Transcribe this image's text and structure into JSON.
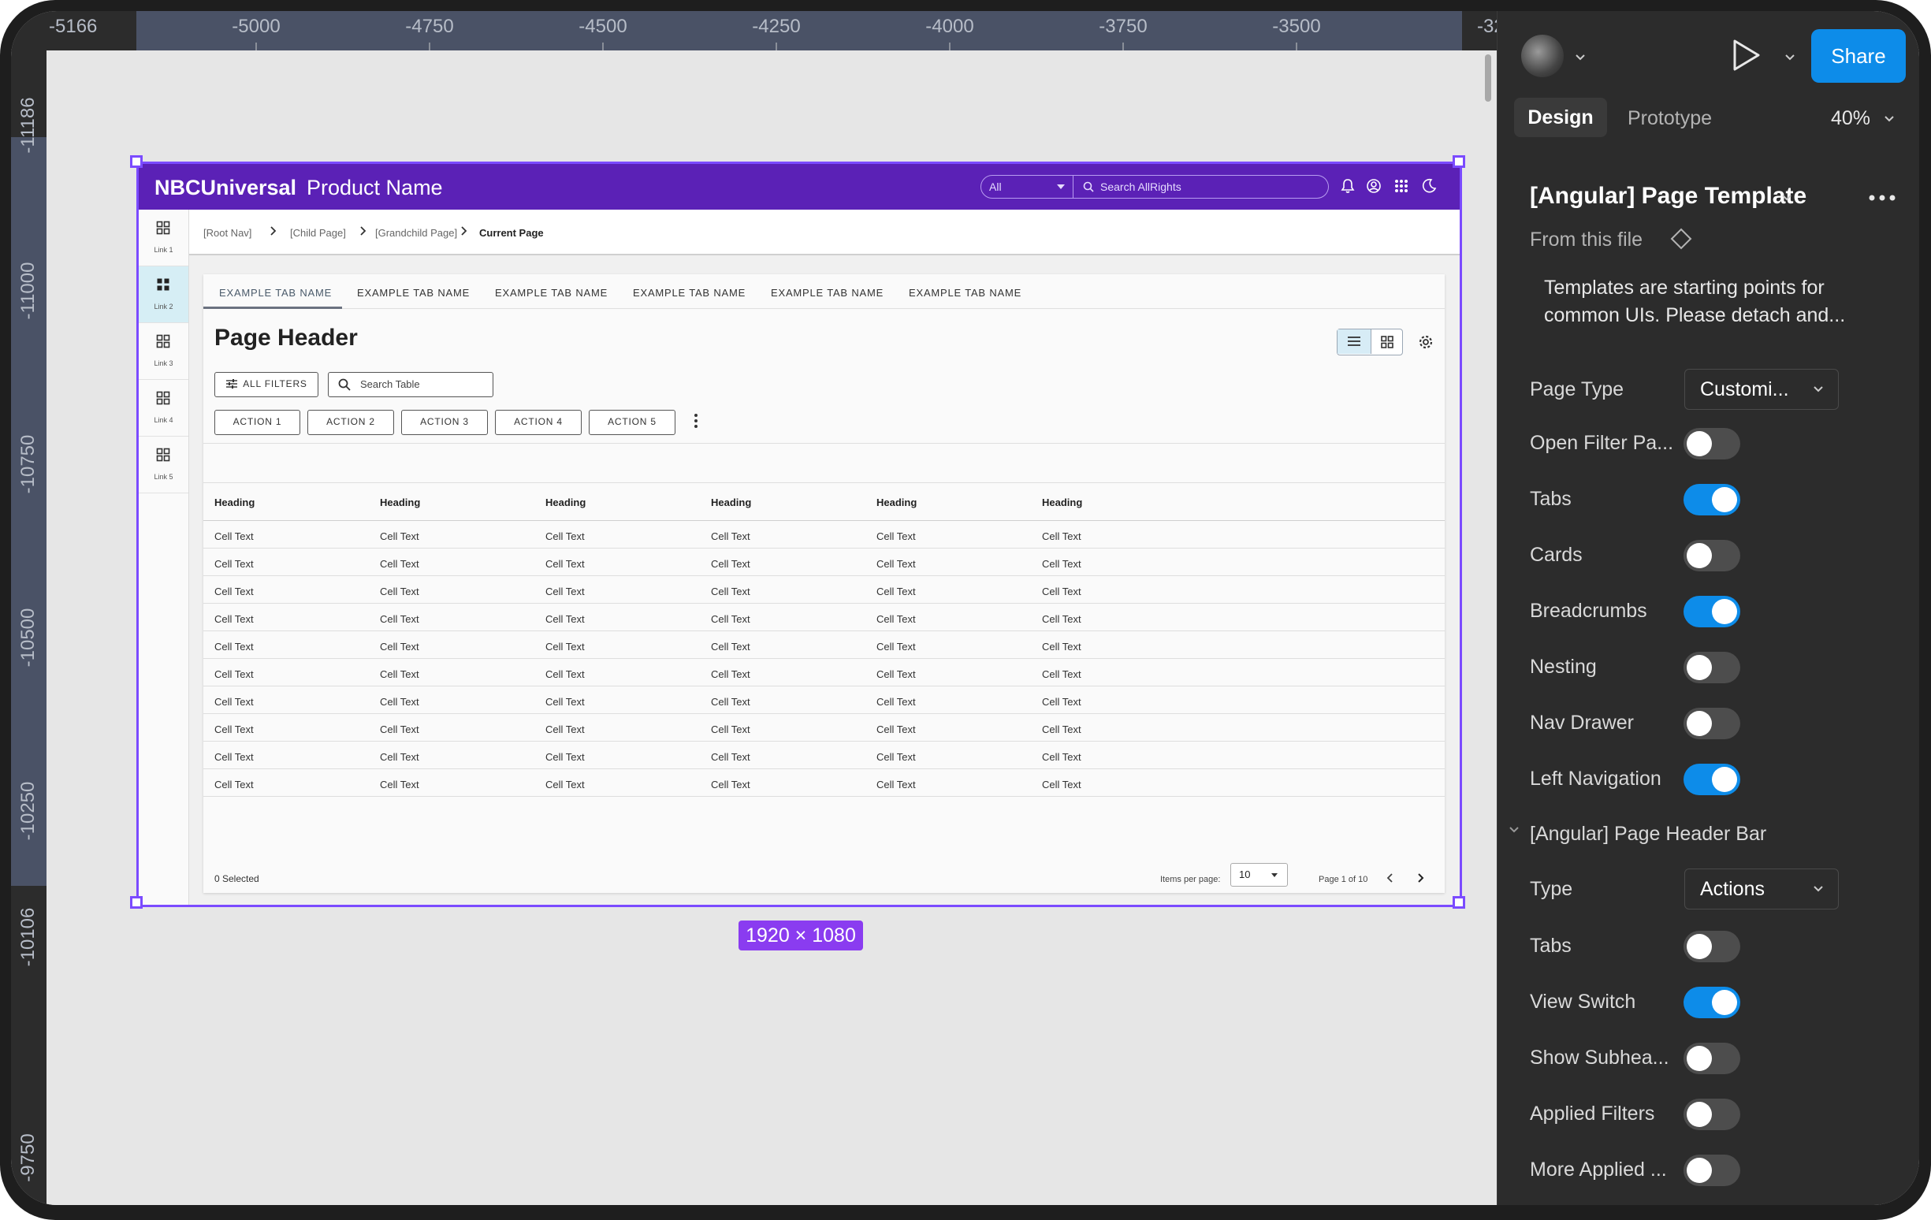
{
  "ruler": {
    "top_ticks": [
      "-5166",
      "-5000",
      "-4750",
      "-4500",
      "-4250",
      "-4000",
      "-3750",
      "-3500",
      "-32"
    ],
    "left_ticks": [
      "-11186",
      "-11000",
      "-10750",
      "-10500",
      "-10250",
      "-10106",
      "-9750"
    ]
  },
  "frame": {
    "size_label": "1920 × 1080"
  },
  "app": {
    "brand": "NBCUniversal",
    "product": "Product Name",
    "scope_value": "All",
    "search_placeholder": "Search AllRights",
    "nav_items": [
      "Link 1",
      "Link 2",
      "Link 3",
      "Link 4",
      "Link 5"
    ],
    "breadcrumbs": [
      "[Root Nav]",
      "[Child Page]",
      "[Grandchild Page]",
      "Current Page"
    ],
    "tabs": [
      "EXAMPLE TAB NAME",
      "EXAMPLE TAB NAME",
      "EXAMPLE TAB NAME",
      "EXAMPLE TAB NAME",
      "EXAMPLE TAB NAME",
      "EXAMPLE TAB NAME"
    ],
    "page_header": "Page Header",
    "all_filters": "ALL FILTERS",
    "search_table": "Search Table",
    "actions": [
      "ACTION 1",
      "ACTION 2",
      "ACTION 3",
      "ACTION 4",
      "ACTION 5"
    ],
    "table": {
      "headers": [
        "Heading",
        "Heading",
        "Heading",
        "Heading",
        "Heading",
        "Heading"
      ],
      "rows": [
        [
          "Cell Text",
          "Cell Text",
          "Cell Text",
          "Cell Text",
          "Cell Text",
          "Cell Text"
        ],
        [
          "Cell Text",
          "Cell Text",
          "Cell Text",
          "Cell Text",
          "Cell Text",
          "Cell Text"
        ],
        [
          "Cell Text",
          "Cell Text",
          "Cell Text",
          "Cell Text",
          "Cell Text",
          "Cell Text"
        ],
        [
          "Cell Text",
          "Cell Text",
          "Cell Text",
          "Cell Text",
          "Cell Text",
          "Cell Text"
        ],
        [
          "Cell Text",
          "Cell Text",
          "Cell Text",
          "Cell Text",
          "Cell Text",
          "Cell Text"
        ],
        [
          "Cell Text",
          "Cell Text",
          "Cell Text",
          "Cell Text",
          "Cell Text",
          "Cell Text"
        ],
        [
          "Cell Text",
          "Cell Text",
          "Cell Text",
          "Cell Text",
          "Cell Text",
          "Cell Text"
        ],
        [
          "Cell Text",
          "Cell Text",
          "Cell Text",
          "Cell Text",
          "Cell Text",
          "Cell Text"
        ],
        [
          "Cell Text",
          "Cell Text",
          "Cell Text",
          "Cell Text",
          "Cell Text",
          "Cell Text"
        ],
        [
          "Cell Text",
          "Cell Text",
          "Cell Text",
          "Cell Text",
          "Cell Text",
          "Cell Text"
        ]
      ]
    },
    "footer": {
      "selected": "0 Selected",
      "items_per_page_label": "Items per page:",
      "items_per_page_value": "10",
      "page_of": "Page 1 of 10"
    }
  },
  "panel": {
    "share": "Share",
    "tab_design": "Design",
    "tab_prototype": "Prototype",
    "zoom": "40%",
    "component_title": "[Angular] Page Template",
    "from_file": "From this file",
    "description": "Templates are starting points for common UIs. Please detach and...",
    "page_type_label": "Page Type",
    "page_type_value": "Customi...",
    "toggles": [
      {
        "label": "Open Filter Pa...",
        "on": false
      },
      {
        "label": "Tabs",
        "on": true
      },
      {
        "label": "Cards",
        "on": false
      },
      {
        "label": "Breadcrumbs",
        "on": true
      },
      {
        "label": "Nesting",
        "on": false
      },
      {
        "label": "Nav Drawer",
        "on": false
      },
      {
        "label": "Left Navigation",
        "on": true
      }
    ],
    "section_title": "[Angular] Page Header Bar",
    "type_label": "Type",
    "type_value": "Actions",
    "section_toggles": [
      {
        "label": "Tabs",
        "on": false
      },
      {
        "label": "View Switch",
        "on": true
      },
      {
        "label": "Show Subhea...",
        "on": false
      },
      {
        "label": "Applied Filters",
        "on": false
      },
      {
        "label": "More Applied ...",
        "on": false
      }
    ]
  },
  "colors": {
    "header_purple": "#5b21b6",
    "selection_purple": "#7b4bff",
    "accent_blue": "#0d8ce9"
  }
}
